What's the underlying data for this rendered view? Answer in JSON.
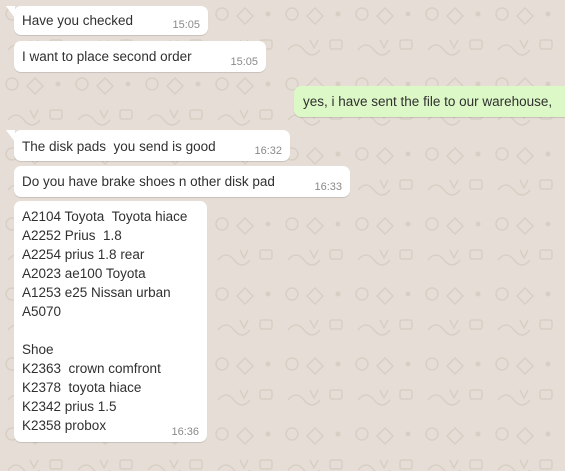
{
  "wallpaper": {
    "background_color": "#e6ded6",
    "pattern_color": "#d9d0c6"
  },
  "messages": [
    {
      "direction": "incoming",
      "text": "Have you checked",
      "time": "15:05"
    },
    {
      "direction": "incoming",
      "text": "I want to place second order",
      "time": "15:05"
    },
    {
      "direction": "outgoing",
      "text": "yes, i have sent the file to our warehouse,",
      "time": ""
    },
    {
      "direction": "incoming",
      "text": "The disk pads  you send is good",
      "time": "16:32"
    },
    {
      "direction": "incoming",
      "text": "Do you have brake shoes n other disk pad",
      "time": "16:33"
    },
    {
      "direction": "incoming",
      "lines": [
        "A2104 Toyota  Toyota hiace",
        "A2252 Prius  1.8",
        "A2254 prius 1.8 rear",
        "A2023 ae100 Toyota",
        "A1253 e25 Nissan urban",
        "A5070",
        "",
        "Shoe",
        "K2363  crown comfront",
        "K2378  toyota hiace",
        "K2342 prius 1.5",
        "K2358 probox"
      ],
      "time": "16:36"
    }
  ],
  "colors": {
    "incoming_bubble": "#ffffff",
    "outgoing_bubble": "#dcf8c6",
    "timestamp": "#8a8a8a"
  }
}
